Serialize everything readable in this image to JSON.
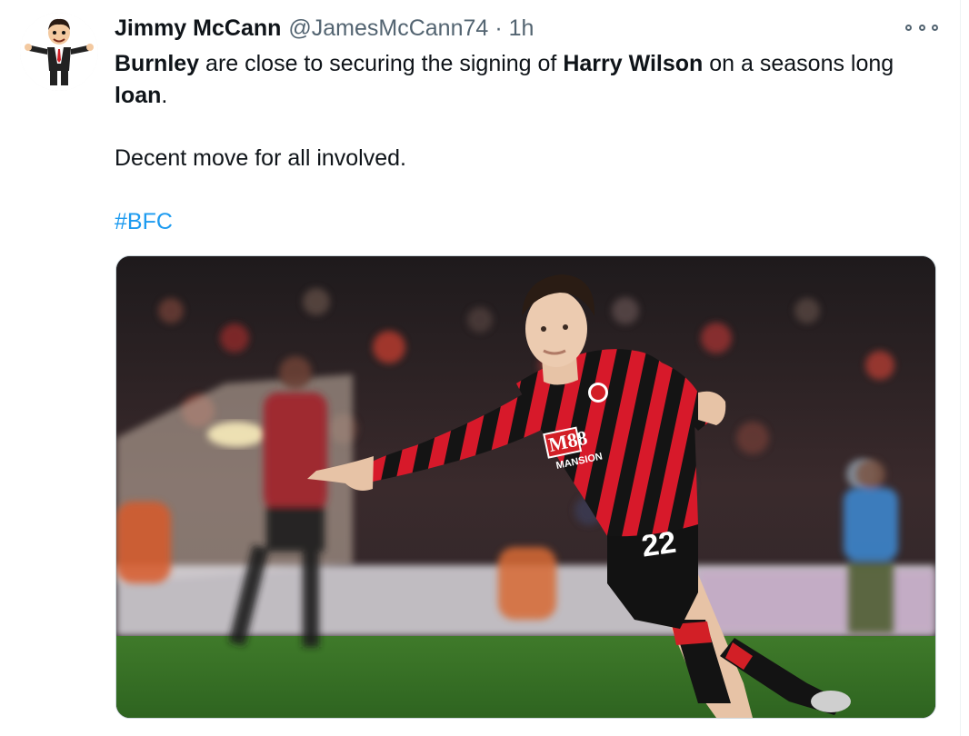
{
  "tweet": {
    "author_name": "Jimmy McCann",
    "handle": "@JamesMcCann74",
    "separator": "·",
    "time": "1h",
    "line1": {
      "bold1": "Burnley",
      "text1": " are close to securing the signing of ",
      "bold2": "Harry Wilson",
      "text2": " on a seasons long"
    },
    "line2": {
      "bold": "loan",
      "text": "."
    },
    "paragraph2": "Decent move for all involved.",
    "hashtag": "#BFC"
  },
  "media": {
    "alt": "Harry Wilson in a red and black striped kit pointing on the pitch",
    "shirt_sponsor": "M88",
    "shirt_sponsor_sub": "MANSION",
    "shirt_number": "22"
  },
  "colors": {
    "link": "#1d9bf0",
    "text": "#0f1419",
    "secondary": "#536471"
  },
  "icons": {
    "more": "more-horizontal-icon"
  }
}
